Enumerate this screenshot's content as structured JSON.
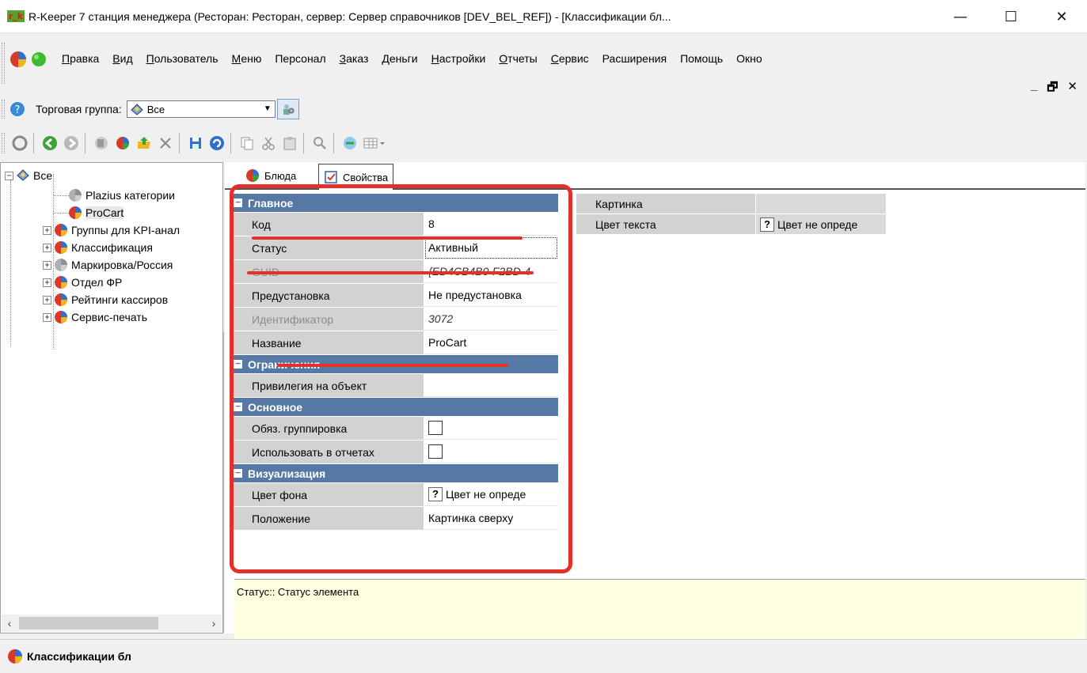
{
  "window": {
    "logo_text": "r_k",
    "title": "R-Keeper 7 станция менеджера (Ресторан: Ресторан, сервер: Сервер справочников [DEV_BEL_REF]) - [Классификации бл...",
    "minimize": "—",
    "maximize": "☐",
    "close": "✕"
  },
  "menu": {
    "items": [
      {
        "accel": "П",
        "rest": "равка"
      },
      {
        "accel": "В",
        "rest": "ид"
      },
      {
        "accel": "П",
        "rest": "ользователь"
      },
      {
        "accel": "М",
        "rest": "еню"
      },
      {
        "accel": "",
        "rest": "Персонал"
      },
      {
        "accel": "З",
        "rest": "аказ"
      },
      {
        "accel": "Д",
        "rest": "еньги"
      },
      {
        "accel": "Н",
        "rest": "астройки"
      },
      {
        "accel": "О",
        "rest": "тчеты"
      },
      {
        "accel": "С",
        "rest": "ервис"
      },
      {
        "accel": "",
        "rest": "Расширения"
      },
      {
        "accel": "",
        "rest": "Помощь"
      },
      {
        "accel": "",
        "rest": "Окно"
      }
    ],
    "mdi_minimize": "_",
    "mdi_restore": "🗗",
    "mdi_close": "✕"
  },
  "group": {
    "label": "Торговая группа:",
    "value": "Все"
  },
  "tree": {
    "root": "Все",
    "items": [
      {
        "label": "Plazius категории",
        "expandable": false,
        "color": "gray"
      },
      {
        "label": "ProCart",
        "expandable": false,
        "color": "color",
        "selected": true
      },
      {
        "label": "Группы для KPI-анал",
        "expandable": true,
        "color": "color"
      },
      {
        "label": "Классификация",
        "expandable": true,
        "color": "color"
      },
      {
        "label": "Маркировка/Россия",
        "expandable": true,
        "color": "gray"
      },
      {
        "label": "Отдел ФР",
        "expandable": true,
        "color": "color"
      },
      {
        "label": "Рейтинги кассиров",
        "expandable": true,
        "color": "color"
      },
      {
        "label": "Сервис-печать",
        "expandable": true,
        "color": "color"
      }
    ]
  },
  "tabs": [
    {
      "label": "Блюда",
      "active": false
    },
    {
      "label": "Свойства",
      "active": true
    }
  ],
  "props": {
    "main": {
      "title": "Главное",
      "code_label": "Код",
      "code_value": "8",
      "status_label": "Статус",
      "status_value": "Активный",
      "guid_label": "GUID",
      "guid_value": "{ED4CB4B0-F2BD-4",
      "preset_label": "Предустановка",
      "preset_value": "Не предустановка",
      "id_label": "Идентификатор",
      "id_value": "3072",
      "name_label": "Название",
      "name_value": "ProCart"
    },
    "limits": {
      "title": "Ограничения",
      "privilege_label": "Привилегия на объект",
      "privilege_value": ""
    },
    "basic": {
      "title": "Основное",
      "required_group_label": "Обяз. группировка",
      "use_in_reports_label": "Использовать в отчетах"
    },
    "visual": {
      "title": "Визуализация",
      "bg_label": "Цвет фона",
      "bg_value": "Цвет не опреде",
      "position_label": "Положение",
      "position_value": "Картинка сверху"
    }
  },
  "props_right": {
    "picture_label": "Картинка",
    "picture_value": "",
    "text_color_label": "Цвет текста",
    "text_color_value": "Цвет не опреде"
  },
  "description": "Статус:: Статус элемента",
  "statusbar": {
    "item": "Классификации бл"
  },
  "colors": {
    "category_header": "#5578a5",
    "annotation_red": "#e4302b",
    "description_bg": "#ffffe1"
  }
}
